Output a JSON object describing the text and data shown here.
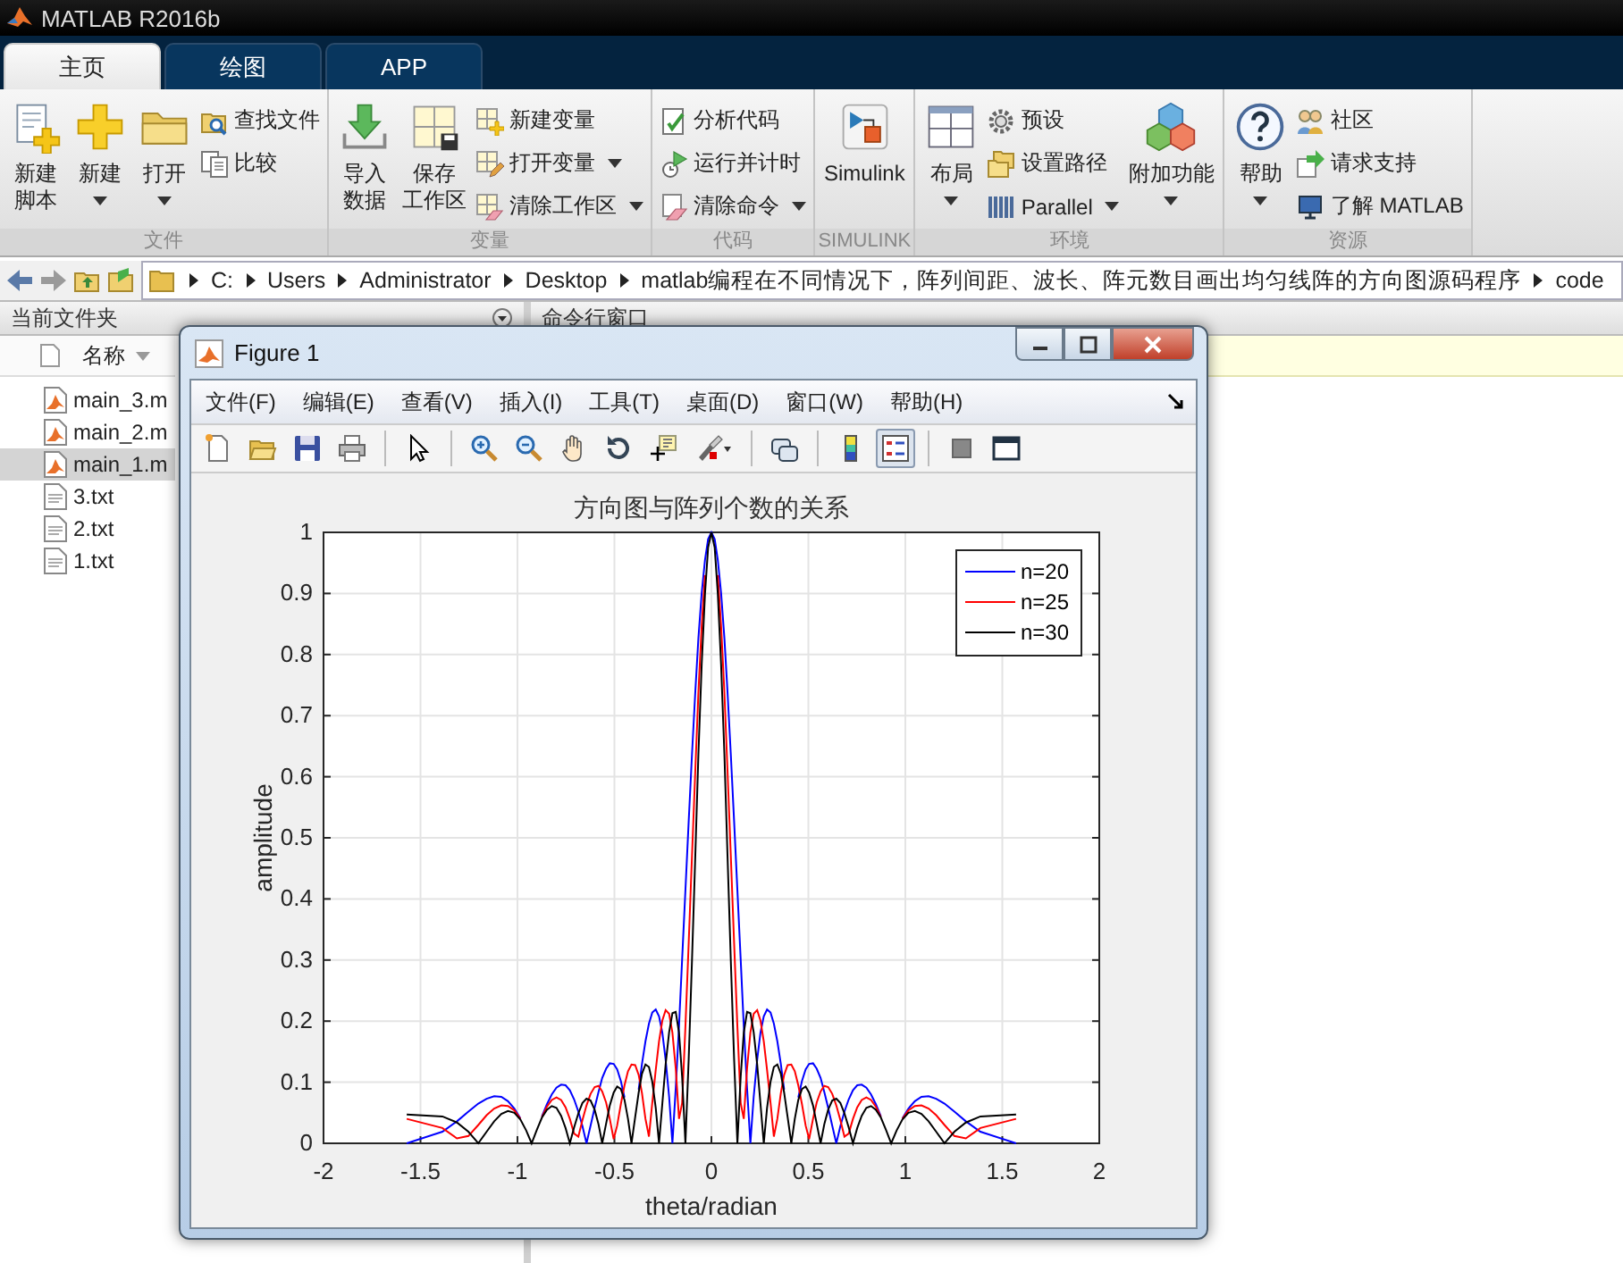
{
  "window": {
    "title": "MATLAB R2016b"
  },
  "tabs": [
    {
      "label": "主页",
      "selected": true
    },
    {
      "label": "绘图",
      "selected": false
    },
    {
      "label": "APP",
      "selected": false
    }
  ],
  "ribbon": {
    "groups": [
      {
        "label": "文件",
        "columns": [
          {
            "kind": "large",
            "lines": [
              "新建",
              "脚本"
            ],
            "dropdown": false
          },
          {
            "kind": "large",
            "lines": [
              "新建"
            ],
            "dropdown": true
          },
          {
            "kind": "large",
            "lines": [
              "打开"
            ],
            "dropdown": true
          },
          {
            "kind": "stack",
            "items": [
              {
                "label": "查找文件",
                "dropdown": false
              },
              {
                "label": "比较",
                "dropdown": false
              }
            ]
          }
        ]
      },
      {
        "label": "变量",
        "columns": [
          {
            "kind": "large",
            "lines": [
              "导入",
              "数据"
            ],
            "dropdown": false
          },
          {
            "kind": "large",
            "lines": [
              "保存",
              "工作区"
            ],
            "dropdown": false
          },
          {
            "kind": "stack",
            "items": [
              {
                "label": "新建变量",
                "dropdown": false
              },
              {
                "label": "打开变量",
                "dropdown": true
              },
              {
                "label": "清除工作区",
                "dropdown": true
              }
            ]
          }
        ]
      },
      {
        "label": "代码",
        "columns": [
          {
            "kind": "stack",
            "items": [
              {
                "label": "分析代码",
                "dropdown": false
              },
              {
                "label": "运行并计时",
                "dropdown": false
              },
              {
                "label": "清除命令",
                "dropdown": true
              }
            ]
          }
        ]
      },
      {
        "label": "SIMULINK",
        "columns": [
          {
            "kind": "large",
            "lines": [
              "Simulink"
            ],
            "dropdown": false
          }
        ]
      },
      {
        "label": "环境",
        "columns": [
          {
            "kind": "large",
            "lines": [
              "布局"
            ],
            "dropdown": true
          },
          {
            "kind": "stack",
            "items": [
              {
                "label": "预设",
                "dropdown": false
              },
              {
                "label": "设置路径",
                "dropdown": false
              },
              {
                "label": "Parallel",
                "dropdown": true
              }
            ]
          },
          {
            "kind": "large",
            "lines": [
              "附加功能"
            ],
            "dropdown": true
          }
        ]
      },
      {
        "label": "资源",
        "columns": [
          {
            "kind": "large",
            "lines": [
              "帮助"
            ],
            "dropdown": true
          },
          {
            "kind": "stack",
            "items": [
              {
                "label": "社区",
                "dropdown": false
              },
              {
                "label": "请求支持",
                "dropdown": false
              },
              {
                "label": "了解 MATLAB",
                "dropdown": false
              }
            ]
          }
        ]
      }
    ]
  },
  "address_bar": {
    "segments": [
      "C:",
      "Users",
      "Administrator",
      "Desktop",
      "matlab编程在不同情况下，阵列间距、波长、阵元数目画出均匀线阵的方向图源码程序",
      "code"
    ]
  },
  "current_folder": {
    "title": "当前文件夹",
    "column": "名称",
    "files": [
      {
        "name": "main_3.m",
        "kind": "m",
        "selected": false
      },
      {
        "name": "main_2.m",
        "kind": "m",
        "selected": false
      },
      {
        "name": "main_1.m",
        "kind": "m",
        "selected": true
      },
      {
        "name": "3.txt",
        "kind": "txt",
        "selected": false
      },
      {
        "name": "2.txt",
        "kind": "txt",
        "selected": false
      },
      {
        "name": "1.txt",
        "kind": "txt",
        "selected": false
      }
    ]
  },
  "command_window": {
    "title": "命令行窗口"
  },
  "figure": {
    "title": "Figure 1",
    "menu": [
      "文件(F)",
      "编辑(E)",
      "查看(V)",
      "插入(I)",
      "工具(T)",
      "桌面(D)",
      "窗口(W)",
      "帮助(H)"
    ],
    "toolbar": [
      [
        {
          "pressed": false
        },
        {
          "pressed": false
        },
        {
          "pressed": false
        },
        {
          "pressed": false
        }
      ],
      [
        {
          "pressed": false
        }
      ],
      [
        {
          "pressed": false
        },
        {
          "pressed": false
        },
        {
          "pressed": false
        },
        {
          "pressed": false
        },
        {
          "pressed": false
        },
        {
          "pressed": false
        }
      ],
      [
        {
          "pressed": false
        }
      ],
      [
        {
          "pressed": false
        },
        {
          "pressed": true
        }
      ],
      [
        {
          "pressed": false
        },
        {
          "pressed": false
        }
      ]
    ],
    "chart_data": {
      "type": "line",
      "title": "方向图与阵列个数的关系",
      "xlabel": "theta/radian",
      "ylabel": "amplitude",
      "x": [
        -1.571,
        -1.387,
        -1.312,
        -1.253,
        -1.202,
        -1.159,
        -1.12,
        -1.083,
        -1.049,
        -1.016,
        -0.985,
        -0.955,
        -0.927,
        -0.9,
        -0.874,
        -0.848,
        -0.823,
        -0.799,
        -0.775,
        -0.752,
        -0.73,
        -0.708,
        -0.686,
        -0.665,
        -0.644,
        -0.623,
        -0.602,
        -0.582,
        -0.563,
        -0.543,
        -0.524,
        -0.504,
        -0.486,
        -0.467,
        -0.448,
        -0.43,
        -0.412,
        -0.393,
        -0.375,
        -0.358,
        -0.34,
        -0.322,
        -0.305,
        -0.287,
        -0.27,
        -0.253,
        -0.236,
        -0.218,
        -0.201,
        -0.184,
        -0.167,
        -0.151,
        -0.134,
        -0.117,
        -0.1,
        -0.083,
        -0.067,
        -0.05,
        -0.033,
        -0.017,
        0,
        0.017,
        0.033,
        0.05,
        0.067,
        0.083,
        0.1,
        0.117,
        0.134,
        0.151,
        0.167,
        0.184,
        0.201,
        0.218,
        0.236,
        0.253,
        0.27,
        0.287,
        0.305,
        0.322,
        0.34,
        0.358,
        0.375,
        0.393,
        0.412,
        0.43,
        0.448,
        0.467,
        0.486,
        0.504,
        0.524,
        0.543,
        0.563,
        0.582,
        0.602,
        0.623,
        0.644,
        0.665,
        0.686,
        0.708,
        0.73,
        0.752,
        0.775,
        0.799,
        0.823,
        0.848,
        0.874,
        0.9,
        0.927,
        0.955,
        0.985,
        1.016,
        1.049,
        1.083,
        1.12,
        1.159,
        1.202,
        1.253,
        1.312,
        1.387,
        1.571
      ],
      "series": [
        {
          "name": "n=20",
          "color": "#0000ff",
          "values": [
            0,
            0.019,
            0.036,
            0.052,
            0.065,
            0.073,
            0.077,
            0.076,
            0.069,
            0.057,
            0.041,
            null,
            null,
            null,
            0.044,
            0.064,
            0.08,
            0.091,
            0.096,
            0.095,
            0.087,
            0.072,
            0.052,
            0.028,
            0,
            0.029,
            0.058,
            0.084,
            0.107,
            0.122,
            0.131,
            0.13,
            0.121,
            0.102,
            0.075,
            null,
            null,
            null,
            0.088,
            0.13,
            0.167,
            0.196,
            0.214,
            0.219,
            0.208,
            0.181,
            0.137,
            0.076,
            0,
            0.09,
            0.192,
            0.301,
            0.414,
            0.528,
            0.637,
            0.739,
            0.827,
            0.901,
            0.955,
            0.989,
            1,
            0.989,
            0.955,
            0.901,
            0.827,
            0.739,
            0.637,
            0.528,
            0.414,
            0.301,
            0.192,
            0.09,
            0,
            0.076,
            0.137,
            0.181,
            0.208,
            0.219,
            0.214,
            0.196,
            0.167,
            0.13,
            0.088,
            null,
            null,
            null,
            0.075,
            0.102,
            0.121,
            0.13,
            0.131,
            0.122,
            0.107,
            0.084,
            0.058,
            0.029,
            0,
            0.028,
            0.052,
            0.072,
            0.087,
            0.095,
            0.096,
            0.091,
            0.08,
            0.064,
            0.044,
            null,
            null,
            null,
            0.041,
            0.057,
            0.069,
            0.076,
            0.077,
            0.073,
            0.065,
            0.052,
            0.036,
            0.019,
            0
          ]
        },
        {
          "name": "n=25",
          "color": "#ff0000",
          "values": [
            0.04,
            0.025,
            0.008,
            0.012,
            0.03,
            0.046,
            0.057,
            0.062,
            0.061,
            0.054,
            0.04,
            null,
            null,
            null,
            0.043,
            0.06,
            0.071,
            0.075,
            0.071,
            0.059,
            0.04,
            0.016,
            0.011,
            0.038,
            0.062,
            0.081,
            0.092,
            0.094,
            0.085,
            0.067,
            0.04,
            0.007,
            0.029,
            0.064,
            0.095,
            0.118,
            0.129,
            0.128,
            0.112,
            0.082,
            0.04,
            0.011,
            0.066,
            0.12,
            0.167,
            0.201,
            0.218,
            0.212,
            0.181,
            0.123,
            0.04,
            0.066,
            0.191,
            0.329,
            0.471,
            0.61,
            0.738,
            0.847,
            0.93,
            null,
            null,
            null,
            0.93,
            0.847,
            0.738,
            0.61,
            0.471,
            0.329,
            0.191,
            0.066,
            0.04,
            0.123,
            0.181,
            0.212,
            0.218,
            0.201,
            0.167,
            0.12,
            0.066,
            0.011,
            0.04,
            0.082,
            0.112,
            0.128,
            0.129,
            0.118,
            0.095,
            0.064,
            0.029,
            0.007,
            0.04,
            0.067,
            0.085,
            0.094,
            0.092,
            0.081,
            0.062,
            0.038,
            0.011,
            0.016,
            0.04,
            0.059,
            0.071,
            0.075,
            0.071,
            0.06,
            0.043,
            null,
            null,
            null,
            0.04,
            0.054,
            0.061,
            0.062,
            0.057,
            0.046,
            0.03,
            0.012,
            0.008,
            0.025,
            0.04
          ]
        },
        {
          "name": "n=30",
          "color": "#000000",
          "values": [
            0.047,
            0.044,
            0.034,
            0.019,
            0,
            0.019,
            0.036,
            0.048,
            0.053,
            0.05,
            0.039,
            0.021,
            0,
            0.022,
            0.042,
            0.055,
            0.061,
            0.058,
            0.045,
            0.025,
            0,
            0.026,
            0.049,
            0.066,
            0.073,
            0.07,
            0.055,
            0.031,
            0,
            0.032,
            0.062,
            0.083,
            0.093,
            0.089,
            0.071,
            0.04,
            0,
            0.043,
            0.083,
            0.114,
            0.129,
            0.125,
            0.101,
            0.058,
            0,
            0.065,
            0.129,
            0.182,
            0.213,
            0.215,
            0.181,
            0.109,
            0,
            0.139,
            0.3,
            0.471,
            0.637,
            0.784,
            0.9,
            0.975,
            1,
            0.975,
            0.9,
            0.784,
            0.637,
            0.471,
            0.3,
            0.139,
            0,
            0.109,
            0.181,
            0.215,
            0.213,
            0.182,
            0.129,
            0.065,
            0,
            0.058,
            0.101,
            0.125,
            0.129,
            0.114,
            0.083,
            0.043,
            0,
            0.04,
            0.071,
            0.089,
            0.093,
            0.083,
            0.062,
            0.032,
            0,
            0.031,
            0.055,
            0.07,
            0.073,
            0.066,
            0.049,
            0.026,
            0,
            0.025,
            0.045,
            0.058,
            0.061,
            0.055,
            0.042,
            0.022,
            0,
            0.021,
            0.039,
            0.05,
            0.053,
            0.048,
            0.036,
            0.019,
            0,
            0.019,
            0.034,
            0.044,
            0.047
          ]
        }
      ],
      "grid": true,
      "legend": true,
      "xlim": [
        -2,
        2
      ],
      "ylim": [
        0,
        1
      ],
      "xticks": [
        -2,
        -1.5,
        -1,
        -0.5,
        0,
        0.5,
        1,
        1.5,
        2
      ],
      "yticks": [
        0,
        0.1,
        0.2,
        0.3,
        0.4,
        0.5,
        0.6,
        0.7,
        0.8,
        0.9,
        1
      ]
    }
  }
}
